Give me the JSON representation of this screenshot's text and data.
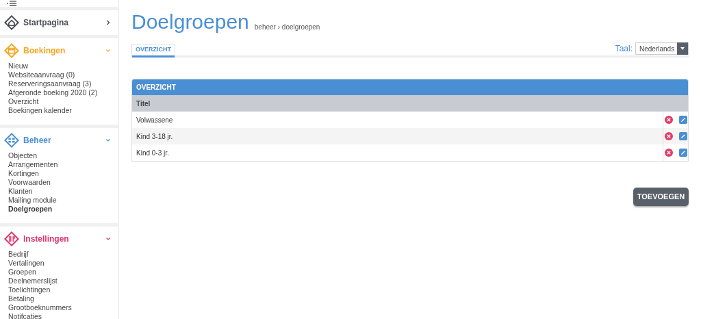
{
  "sidebar": {
    "sections": [
      {
        "title": "Startpagina",
        "color": "#4a4f57",
        "expanded": false
      },
      {
        "title": "Boekingen",
        "color": "#f5a623",
        "expanded": true,
        "items": [
          {
            "label": "Nieuw",
            "selected": false
          },
          {
            "label": "Websiteaanvraag (0)",
            "selected": false
          },
          {
            "label": "Reserveringsaanvraag (3)",
            "selected": false
          },
          {
            "label": "Afgeronde boeking 2020 (2)",
            "selected": false
          },
          {
            "label": "Overzicht",
            "selected": false
          },
          {
            "label": "Boekingen kalender",
            "selected": false
          }
        ]
      },
      {
        "title": "Beheer",
        "color": "#4a8fd4",
        "expanded": true,
        "items": [
          {
            "label": "Objecten",
            "selected": false
          },
          {
            "label": "Arrangementen",
            "selected": false
          },
          {
            "label": "Kortingen",
            "selected": false
          },
          {
            "label": "Voorwaarden",
            "selected": false
          },
          {
            "label": "Klanten",
            "selected": false
          },
          {
            "label": "Mailing module",
            "selected": false
          },
          {
            "label": "Doelgroepen",
            "selected": true
          }
        ]
      },
      {
        "title": "Instellingen",
        "color": "#e0336b",
        "expanded": true,
        "items": [
          {
            "label": "Bedrijf",
            "selected": false
          },
          {
            "label": "Vertalingen",
            "selected": false
          },
          {
            "label": "Groepen",
            "selected": false
          },
          {
            "label": "Deelnemerslijst",
            "selected": false
          },
          {
            "label": "Toelichtingen",
            "selected": false
          },
          {
            "label": "Betaling",
            "selected": false
          },
          {
            "label": "Grootboeknummers",
            "selected": false
          },
          {
            "label": "Notifcaties",
            "selected": false
          }
        ]
      }
    ]
  },
  "page": {
    "title": "Doelgroepen",
    "breadcrumb": "beheer › doelgroepen"
  },
  "tabs": [
    {
      "label": "OVERZICHT",
      "selected": true
    }
  ],
  "language": {
    "label": "Taal:",
    "value": "Nederlands"
  },
  "table": {
    "title": "OVERZICHT",
    "columns": [
      "Titel"
    ],
    "rows": [
      [
        "Volwassene"
      ],
      [
        "Kind 3-18 jr."
      ],
      [
        "Kind 0-3 jr."
      ]
    ]
  },
  "add_button": "TOEVOEGEN"
}
